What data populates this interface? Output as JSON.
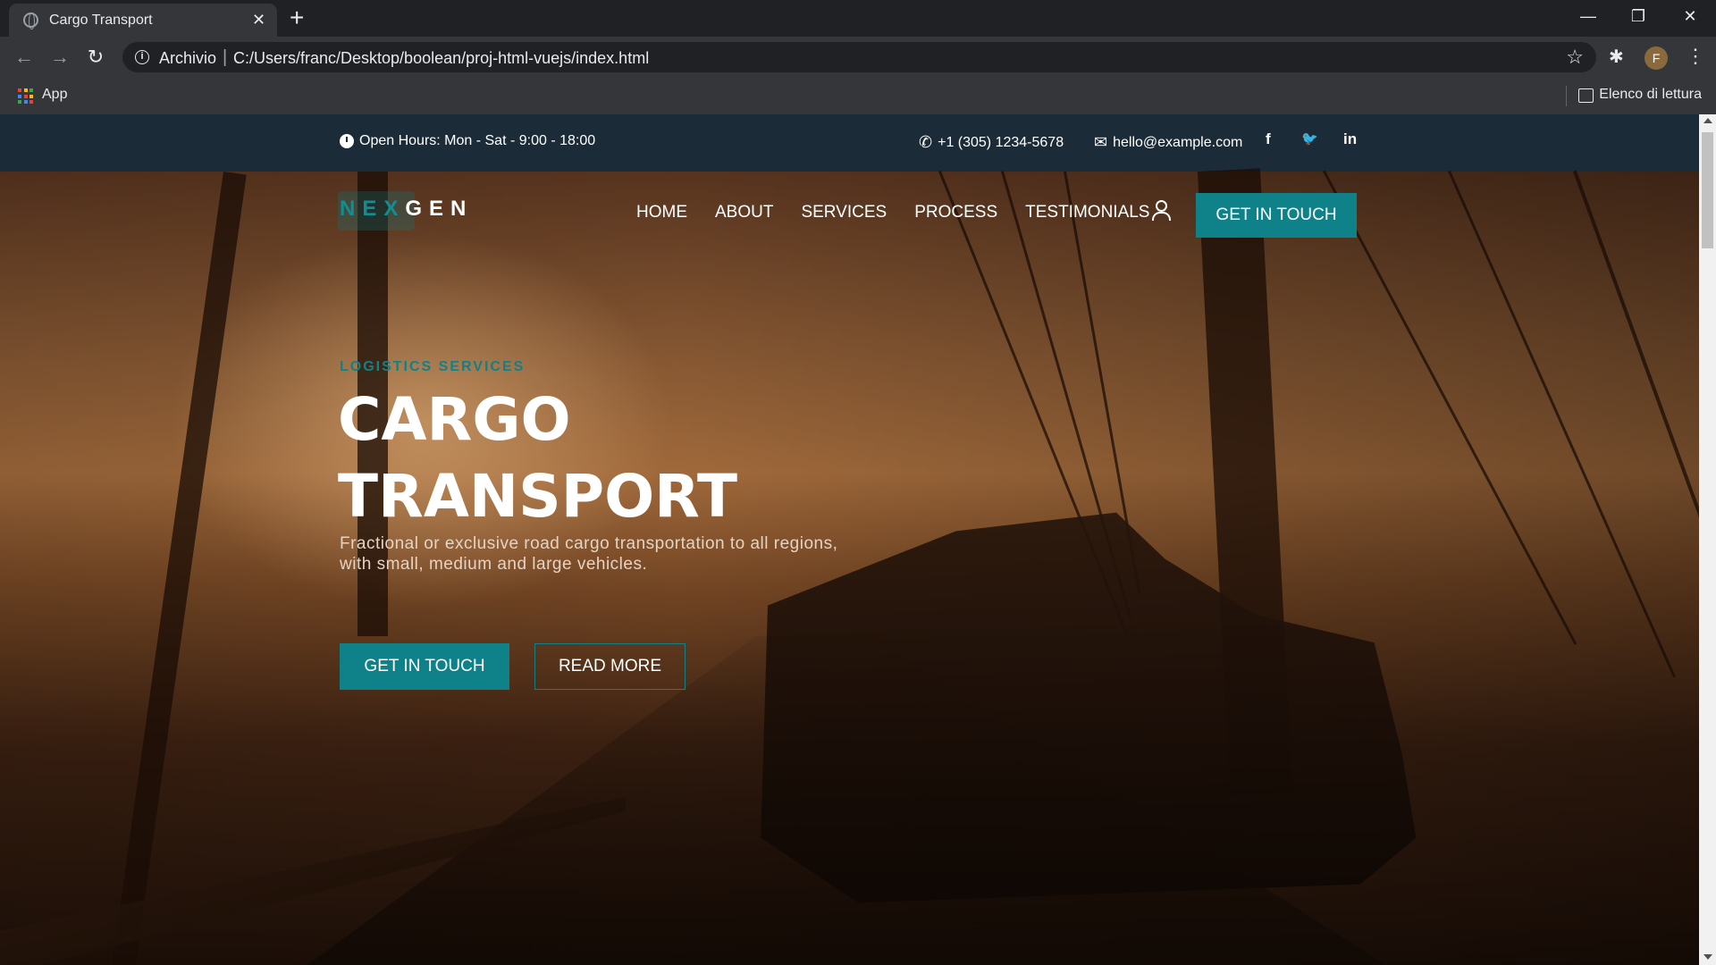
{
  "browser": {
    "tab_title": "Cargo Transport",
    "tab_close": "✕",
    "new_tab": "+",
    "window_controls": {
      "minimize": "—",
      "restore": "❐",
      "close": "✕"
    },
    "back": "←",
    "forward": "→",
    "reload": "↻",
    "scheme_label": "Archivio",
    "separator": "|",
    "url": "C:/Users/franc/Desktop/boolean/proj-html-vuejs/index.html",
    "star": "☆",
    "extensions": "✱",
    "avatar_letter": "F",
    "menu": "⋮",
    "bookmarks": {
      "apps_label": "App",
      "reading_list": "Elenco di lettura"
    }
  },
  "topbar": {
    "open_hours": "Open Hours: Mon - Sat - 9:00 - 18:00",
    "phone_icon": "✆",
    "phone": "+1 (305) 1234-5678",
    "mail_icon": "✉",
    "email": "hello@example.com",
    "social": {
      "facebook": "f",
      "twitter": "🐦",
      "linkedin": "in"
    }
  },
  "nav": {
    "logo_part1": "NEX",
    "logo_part2": "GEN",
    "items": [
      "HOME",
      "ABOUT",
      "SERVICES",
      "PROCESS",
      "TESTIMONIALS"
    ],
    "cta": "GET IN TOUCH"
  },
  "hero": {
    "kicker": "LOGISTICS SERVICES",
    "title_line1": "CARGO",
    "title_line2": "TRANSPORT",
    "subtitle": "Fractional or exclusive road cargo transportation to all regions, with small, medium and large vehicles.",
    "primary_button": "GET IN TOUCH",
    "secondary_button": "READ MORE"
  },
  "colors": {
    "accent": "#0f8289",
    "topbar_bg": "#1c2b38",
    "browser_bg": "#35363a"
  }
}
